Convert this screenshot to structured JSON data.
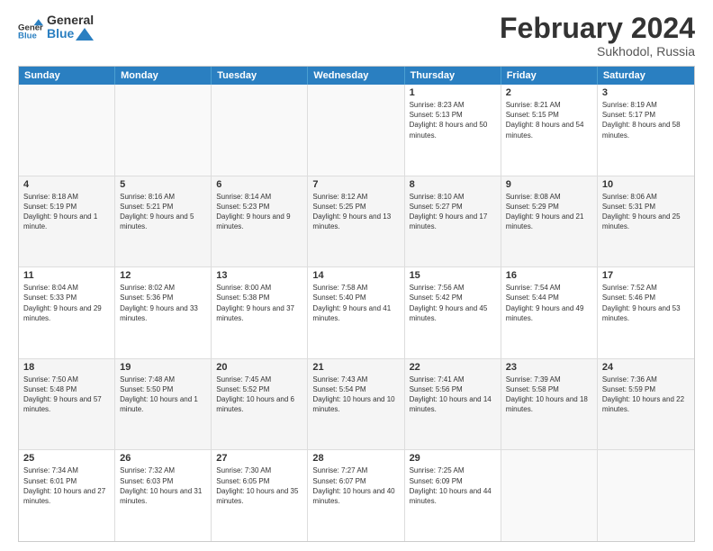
{
  "logo": {
    "text_general": "General",
    "text_blue": "Blue"
  },
  "header": {
    "title": "February 2024",
    "subtitle": "Sukhodol, Russia"
  },
  "weekdays": [
    "Sunday",
    "Monday",
    "Tuesday",
    "Wednesday",
    "Thursday",
    "Friday",
    "Saturday"
  ],
  "rows": [
    {
      "cells": [
        {
          "empty": true
        },
        {
          "empty": true
        },
        {
          "empty": true
        },
        {
          "empty": true
        },
        {
          "day": 1,
          "sunrise": "8:23 AM",
          "sunset": "5:13 PM",
          "daylight": "8 hours and 50 minutes."
        },
        {
          "day": 2,
          "sunrise": "8:21 AM",
          "sunset": "5:15 PM",
          "daylight": "8 hours and 54 minutes."
        },
        {
          "day": 3,
          "sunrise": "8:19 AM",
          "sunset": "5:17 PM",
          "daylight": "8 hours and 58 minutes."
        }
      ]
    },
    {
      "cells": [
        {
          "day": 4,
          "sunrise": "8:18 AM",
          "sunset": "5:19 PM",
          "daylight": "9 hours and 1 minute."
        },
        {
          "day": 5,
          "sunrise": "8:16 AM",
          "sunset": "5:21 PM",
          "daylight": "9 hours and 5 minutes."
        },
        {
          "day": 6,
          "sunrise": "8:14 AM",
          "sunset": "5:23 PM",
          "daylight": "9 hours and 9 minutes."
        },
        {
          "day": 7,
          "sunrise": "8:12 AM",
          "sunset": "5:25 PM",
          "daylight": "9 hours and 13 minutes."
        },
        {
          "day": 8,
          "sunrise": "8:10 AM",
          "sunset": "5:27 PM",
          "daylight": "9 hours and 17 minutes."
        },
        {
          "day": 9,
          "sunrise": "8:08 AM",
          "sunset": "5:29 PM",
          "daylight": "9 hours and 21 minutes."
        },
        {
          "day": 10,
          "sunrise": "8:06 AM",
          "sunset": "5:31 PM",
          "daylight": "9 hours and 25 minutes."
        }
      ]
    },
    {
      "cells": [
        {
          "day": 11,
          "sunrise": "8:04 AM",
          "sunset": "5:33 PM",
          "daylight": "9 hours and 29 minutes."
        },
        {
          "day": 12,
          "sunrise": "8:02 AM",
          "sunset": "5:36 PM",
          "daylight": "9 hours and 33 minutes."
        },
        {
          "day": 13,
          "sunrise": "8:00 AM",
          "sunset": "5:38 PM",
          "daylight": "9 hours and 37 minutes."
        },
        {
          "day": 14,
          "sunrise": "7:58 AM",
          "sunset": "5:40 PM",
          "daylight": "9 hours and 41 minutes."
        },
        {
          "day": 15,
          "sunrise": "7:56 AM",
          "sunset": "5:42 PM",
          "daylight": "9 hours and 45 minutes."
        },
        {
          "day": 16,
          "sunrise": "7:54 AM",
          "sunset": "5:44 PM",
          "daylight": "9 hours and 49 minutes."
        },
        {
          "day": 17,
          "sunrise": "7:52 AM",
          "sunset": "5:46 PM",
          "daylight": "9 hours and 53 minutes."
        }
      ]
    },
    {
      "cells": [
        {
          "day": 18,
          "sunrise": "7:50 AM",
          "sunset": "5:48 PM",
          "daylight": "9 hours and 57 minutes."
        },
        {
          "day": 19,
          "sunrise": "7:48 AM",
          "sunset": "5:50 PM",
          "daylight": "10 hours and 1 minute."
        },
        {
          "day": 20,
          "sunrise": "7:45 AM",
          "sunset": "5:52 PM",
          "daylight": "10 hours and 6 minutes."
        },
        {
          "day": 21,
          "sunrise": "7:43 AM",
          "sunset": "5:54 PM",
          "daylight": "10 hours and 10 minutes."
        },
        {
          "day": 22,
          "sunrise": "7:41 AM",
          "sunset": "5:56 PM",
          "daylight": "10 hours and 14 minutes."
        },
        {
          "day": 23,
          "sunrise": "7:39 AM",
          "sunset": "5:58 PM",
          "daylight": "10 hours and 18 minutes."
        },
        {
          "day": 24,
          "sunrise": "7:36 AM",
          "sunset": "5:59 PM",
          "daylight": "10 hours and 22 minutes."
        }
      ]
    },
    {
      "cells": [
        {
          "day": 25,
          "sunrise": "7:34 AM",
          "sunset": "6:01 PM",
          "daylight": "10 hours and 27 minutes."
        },
        {
          "day": 26,
          "sunrise": "7:32 AM",
          "sunset": "6:03 PM",
          "daylight": "10 hours and 31 minutes."
        },
        {
          "day": 27,
          "sunrise": "7:30 AM",
          "sunset": "6:05 PM",
          "daylight": "10 hours and 35 minutes."
        },
        {
          "day": 28,
          "sunrise": "7:27 AM",
          "sunset": "6:07 PM",
          "daylight": "10 hours and 40 minutes."
        },
        {
          "day": 29,
          "sunrise": "7:25 AM",
          "sunset": "6:09 PM",
          "daylight": "10 hours and 44 minutes."
        },
        {
          "empty": true
        },
        {
          "empty": true
        }
      ]
    }
  ]
}
